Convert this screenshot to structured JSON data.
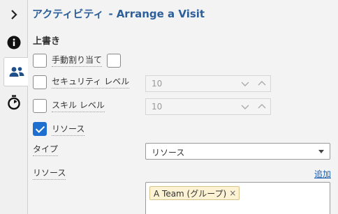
{
  "rail": {
    "items": [
      {
        "icon": "chevron-right-icon"
      },
      {
        "icon": "info-icon"
      },
      {
        "icon": "people-icon",
        "active": true
      },
      {
        "icon": "stopwatch-icon"
      }
    ]
  },
  "header": {
    "title": "アクティビティ",
    "separator": "-",
    "subtitle": "Arrange a Visit"
  },
  "overrides": {
    "section_title": "上書き",
    "manual_assign_label": "手動割り当て",
    "security_level_label": "セキュリティ レベル",
    "security_level_value": "10",
    "skill_level_label": "スキル レベル",
    "skill_level_value": "10",
    "resource_label": "リソース"
  },
  "type_field": {
    "label": "タイプ",
    "value": "リソース"
  },
  "resources_field": {
    "label": "リソース",
    "add_link": "追加",
    "tags": [
      {
        "label": "A Team (グループ)",
        "remove": "×"
      }
    ]
  },
  "colors": {
    "accent": "#1e6fd0",
    "title": "#2d5f9a",
    "icon": "#1e4f8a",
    "tag_bg": "#fdf3d4"
  }
}
